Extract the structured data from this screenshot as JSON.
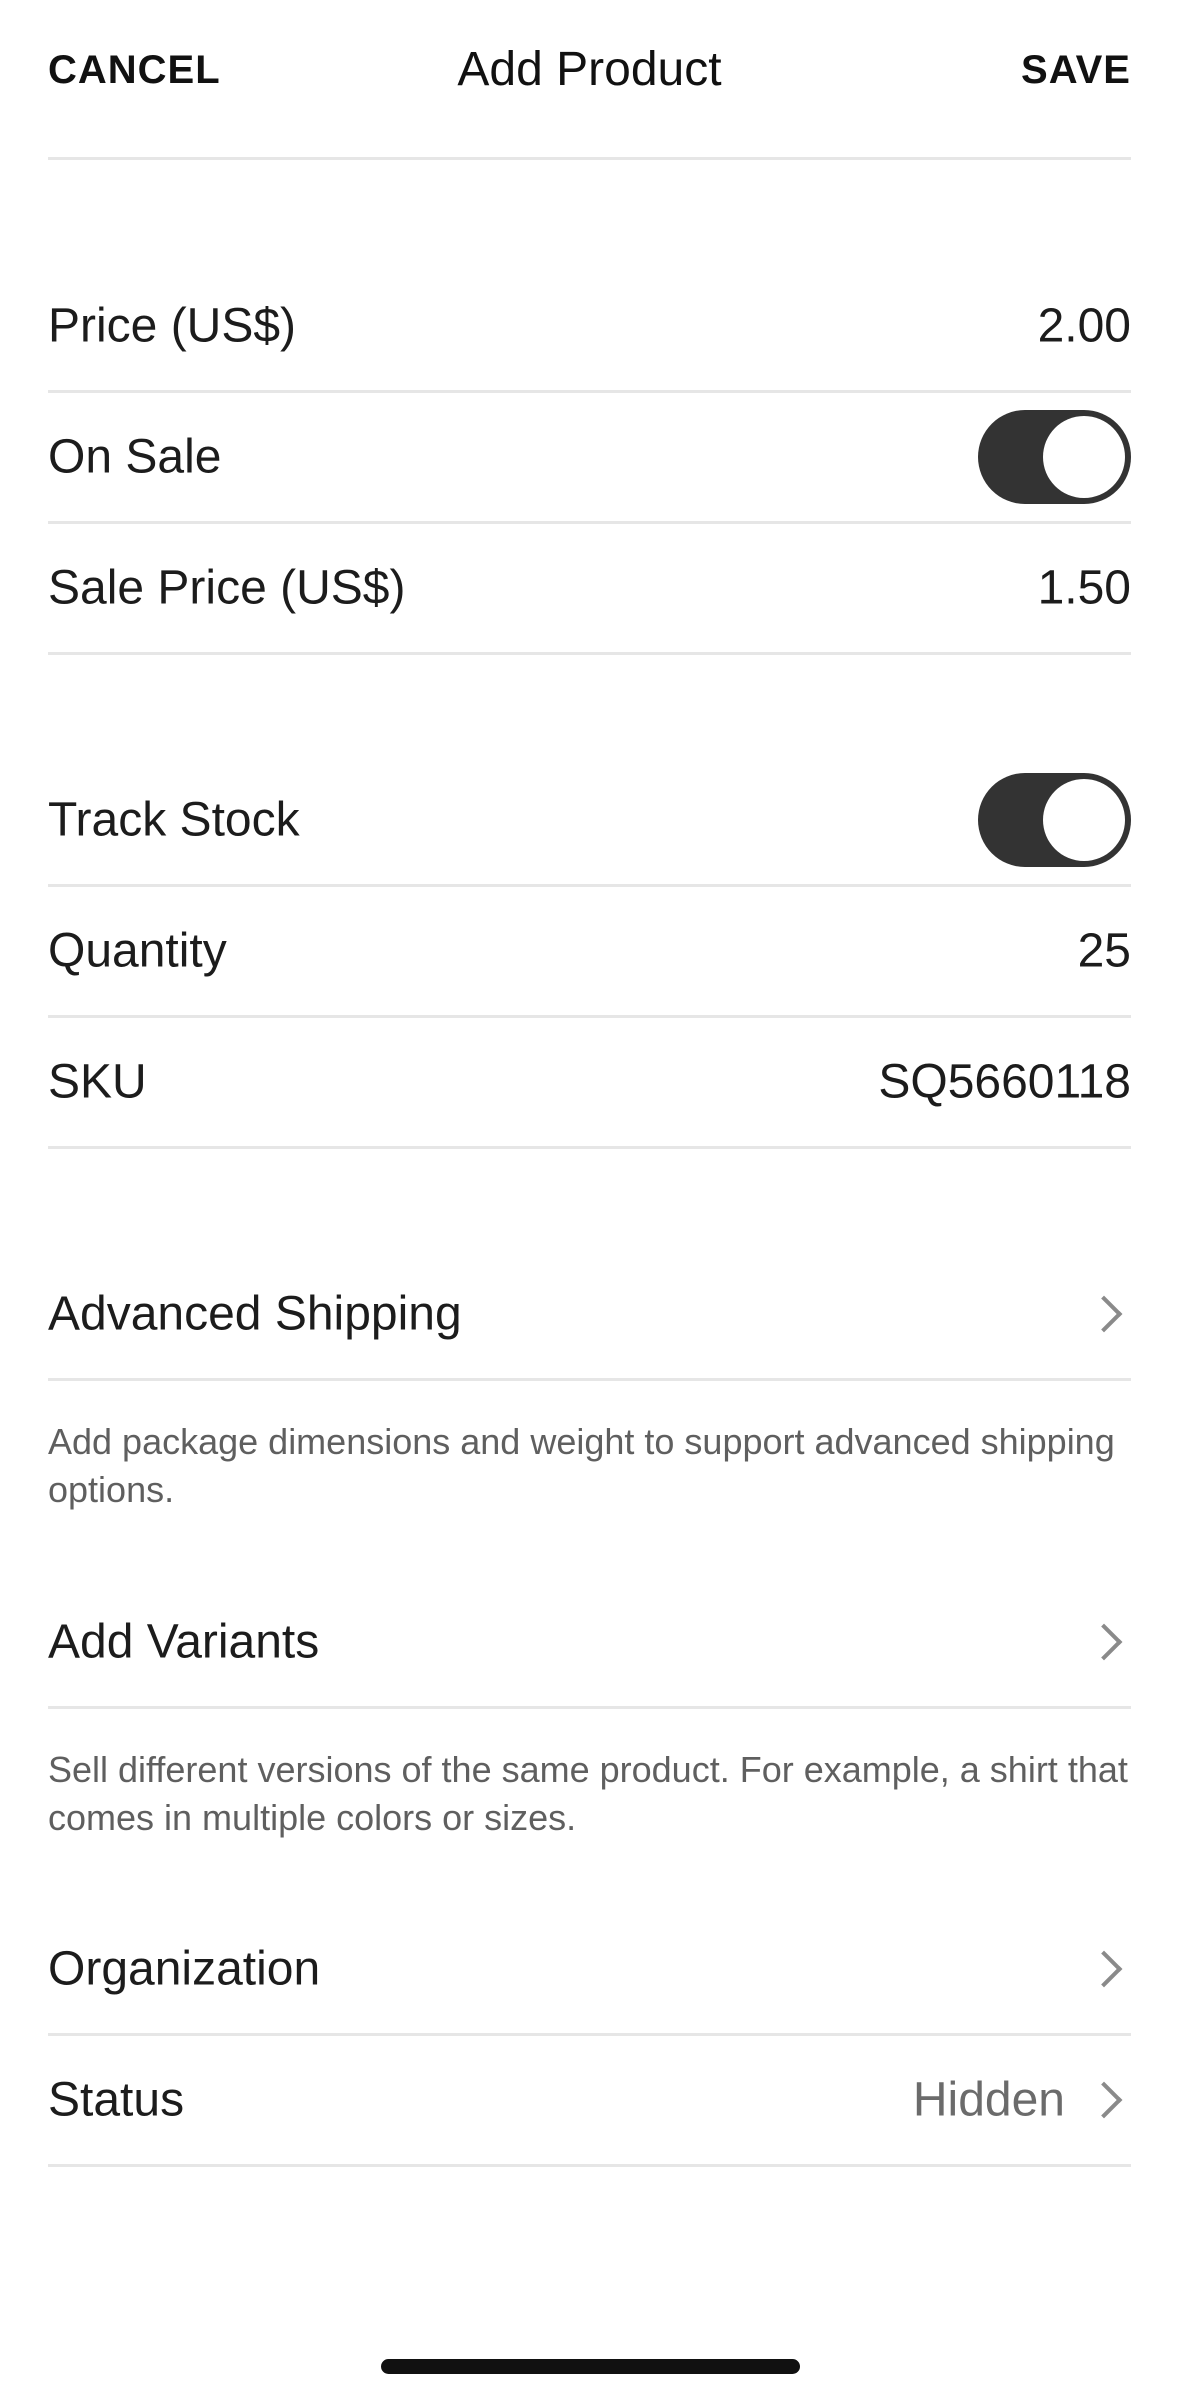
{
  "header": {
    "cancel_label": "CANCEL",
    "title": "Add Product",
    "save_label": "SAVE"
  },
  "pricing": {
    "price_label": "Price (US$)",
    "price_value": "2.00",
    "on_sale_label": "On Sale",
    "on_sale_enabled": true,
    "sale_price_label": "Sale Price (US$)",
    "sale_price_value": "1.50"
  },
  "inventory": {
    "track_stock_label": "Track Stock",
    "track_stock_enabled": true,
    "quantity_label": "Quantity",
    "quantity_value": "25",
    "sku_label": "SKU",
    "sku_value": "SQ5660118"
  },
  "advanced_shipping": {
    "label": "Advanced Shipping",
    "helper": "Add package dimensions and weight to support advanced shipping options."
  },
  "variants": {
    "label": "Add Variants",
    "helper": "Sell different versions of the same product. For example, a shirt that comes in multiple colors or sizes."
  },
  "organization": {
    "label": "Organization"
  },
  "status": {
    "label": "Status",
    "value": "Hidden"
  },
  "colors": {
    "toggle_on": "#333333",
    "divider": "#e6e6e6",
    "helper_text": "#5f5f5f"
  }
}
